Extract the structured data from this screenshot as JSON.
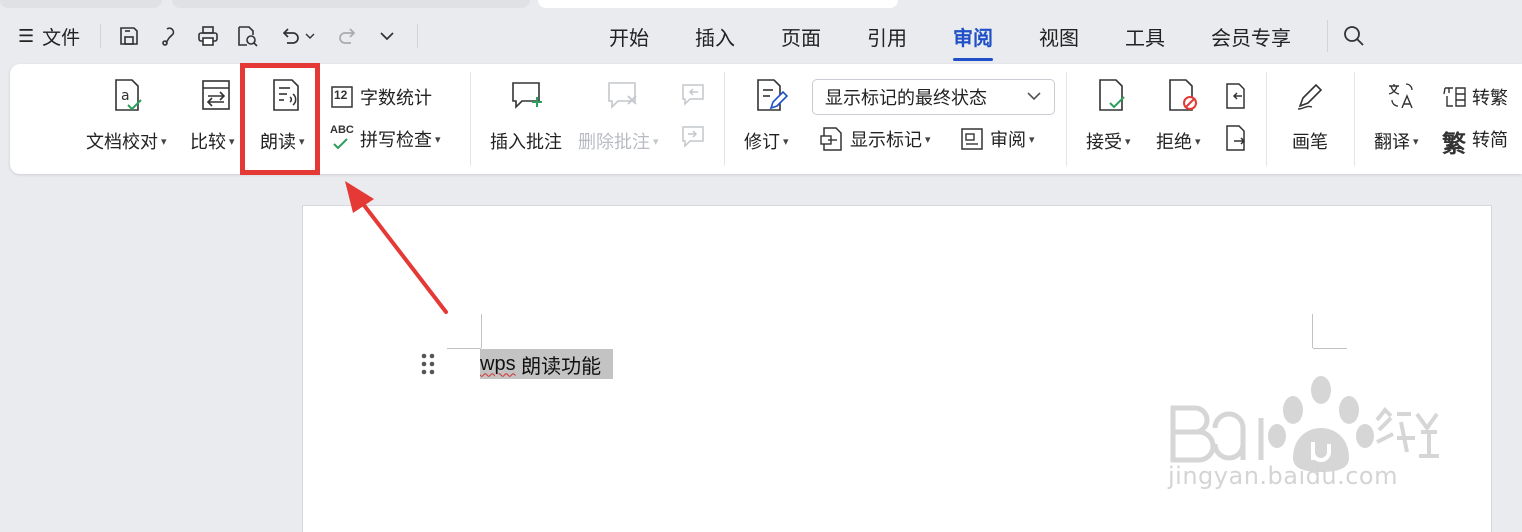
{
  "menubar": {
    "file_label": "文件",
    "tabs": [
      "开始",
      "插入",
      "页面",
      "引用",
      "审阅",
      "视图",
      "工具",
      "会员专享"
    ],
    "active_tab": "审阅"
  },
  "ribbon": {
    "doc_proofread": "文档校对",
    "compare": "比较",
    "read_aloud": "朗读",
    "word_count": "字数统计",
    "spell_check": "拼写检查",
    "insert_comment": "插入批注",
    "delete_comment": "删除批注",
    "revise": "修订",
    "show_markup_state": "显示标记的最终状态",
    "show_markup": "显示标记",
    "review": "审阅",
    "accept": "接受",
    "reject": "拒绝",
    "pen": "画笔",
    "translate": "翻译",
    "to_traditional": "转繁",
    "to_simplified": "转简",
    "word_count_badge": "12",
    "spell_badge": "ABC",
    "trad_glyph": "繁"
  },
  "document": {
    "text_word": "wps",
    "text_rest": " 朗读功能"
  },
  "watermark": {
    "url": "jingyan.baidu.com"
  },
  "colors": {
    "accent": "#2050c8",
    "highlight": "#e53935",
    "accept_green": "#2e9e5b",
    "reject_red": "#e53935"
  }
}
